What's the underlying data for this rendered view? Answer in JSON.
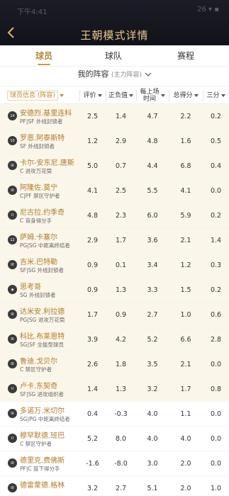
{
  "status": {
    "time": "下午4:41",
    "right": "26 ▾ ▪"
  },
  "header": {
    "title": "王朝模式详情"
  },
  "tabs": [
    {
      "label": "球员"
    },
    {
      "label": "球队"
    },
    {
      "label": "赛程"
    }
  ],
  "lineup": {
    "label": "我的阵容",
    "sub": "(主力阵容)"
  },
  "columns": {
    "info": "球员信息 (阵容)",
    "rating": "评价",
    "plusminus": "正负值",
    "minutes_l1": "每上场",
    "minutes_l2": "时间",
    "points": "总得分",
    "three": "三分"
  },
  "colors": {
    "accent": "#c79a4a",
    "title": "#e9c98a",
    "name": "#b07c2a",
    "header_bg": "#1a1a22",
    "gold_row": "#fbf6ea"
  },
  "players": [
    {
      "badge": "14",
      "name": "安德烈.基里连科",
      "desc": "PF|SF 外线封锁者",
      "rating": "2.5",
      "pm": "1.4",
      "min": "4.7",
      "pts": "2.2",
      "three": "0.2",
      "gold": true
    },
    {
      "badge": "10",
      "name": "罗恩.阿泰斯特",
      "desc": "SF 外线封锁者",
      "rating": "1.2",
      "pm": "2.9",
      "min": "4.8",
      "pts": "1.6",
      "three": "0.5",
      "gold": true
    },
    {
      "badge": "III",
      "name": "卡尔-安东尼.唐斯",
      "desc": "C 进攻万花筒",
      "rating": "5.0",
      "pm": "0.7",
      "min": "4.4",
      "pts": "6.8",
      "three": "0.4",
      "gold": true
    },
    {
      "badge": "III",
      "name": "阿隆佐.莫宁",
      "desc": "C|PF 禁区守护者",
      "rating": "4.1",
      "pm": "2.5",
      "min": "5.5",
      "pts": "4.1",
      "three": "0.0",
      "gold": true
    },
    {
      "badge": "II",
      "name": "尼古拉.约季奇",
      "desc": "C 背身得分手",
      "rating": "4.8",
      "pm": "2.3",
      "min": "6.0",
      "pts": "5.9",
      "three": "0.2",
      "gold": true
    },
    {
      "badge": "12",
      "name": "萨姆.卡塞尔",
      "desc": "PG|SG 中距离终结者",
      "rating": "2.9",
      "pm": "1.7",
      "min": "3.6",
      "pts": "2.1",
      "three": "1.4",
      "gold": true
    },
    {
      "badge": "III",
      "name": "吉米.巴特勒",
      "desc": "SF|SG 外线封锁者",
      "rating": "0.9",
      "pm": "0.1",
      "min": "3.4",
      "pts": "1.2",
      "three": "0.3",
      "gold": true
    },
    {
      "badge": "◆",
      "name": "思考哥",
      "desc": "SG 外线封锁者",
      "rating": "0.9",
      "pm": "1.3",
      "min": "3.3",
      "pts": "1.5",
      "three": "0.2",
      "gold": true
    },
    {
      "badge": "III",
      "name": "达米安.利拉德",
      "desc": "PG|SG 进攻万花筒",
      "rating": "1.7",
      "pm": "0.9",
      "min": "2.7",
      "pts": "1.0",
      "three": "0.6",
      "gold": true
    },
    {
      "badge": "III",
      "name": "科比.布莱恩特",
      "desc": "SG|SF 全能型球员",
      "rating": "3.9",
      "pm": "4.2",
      "min": "5.2",
      "pts": "6.6",
      "three": "2.8",
      "gold": true
    },
    {
      "badge": "III",
      "name": "鲁迪.戈贝尔",
      "desc": "C 禁区守护者",
      "rating": "2.6",
      "pm": "1.8",
      "min": "3.5",
      "pts": "2.1",
      "three": "0.0",
      "gold": true
    },
    {
      "badge": "II",
      "name": "卢卡.东契奇",
      "desc": "SF|SG 进攻组织者",
      "rating": "1.4",
      "pm": "1.3",
      "min": "3.2",
      "pts": "1.7",
      "three": "0.8",
      "gold": true
    },
    {
      "badge": "III",
      "name": "多诺万.米切尔",
      "desc": "SG|PG 中距离终结者",
      "rating": "0.4",
      "pm": "-0.3",
      "min": "4.0",
      "pts": "1.1",
      "three": "0.0",
      "gold": false
    },
    {
      "badge": "II",
      "name": "穆罕默德.班巴",
      "desc": "C 禁区守护者",
      "rating": "5.2",
      "pm": "8.0",
      "min": "4.0",
      "pts": "4.0",
      "three": "0.0",
      "gold": false
    },
    {
      "badge": "III",
      "name": "德里克.费佛斯",
      "desc": "PF|C 篮下得分手",
      "rating": "-1.6",
      "pm": "-8.0",
      "min": "3.0",
      "pts": "2.0",
      "three": "0.0",
      "gold": false
    },
    {
      "badge": "III",
      "name": "德雷蒙德.格林",
      "desc": "",
      "rating": "3.2",
      "pm": "2.7",
      "min": "5.1",
      "pts": "2.0",
      "three": "1.0",
      "gold": false
    }
  ]
}
